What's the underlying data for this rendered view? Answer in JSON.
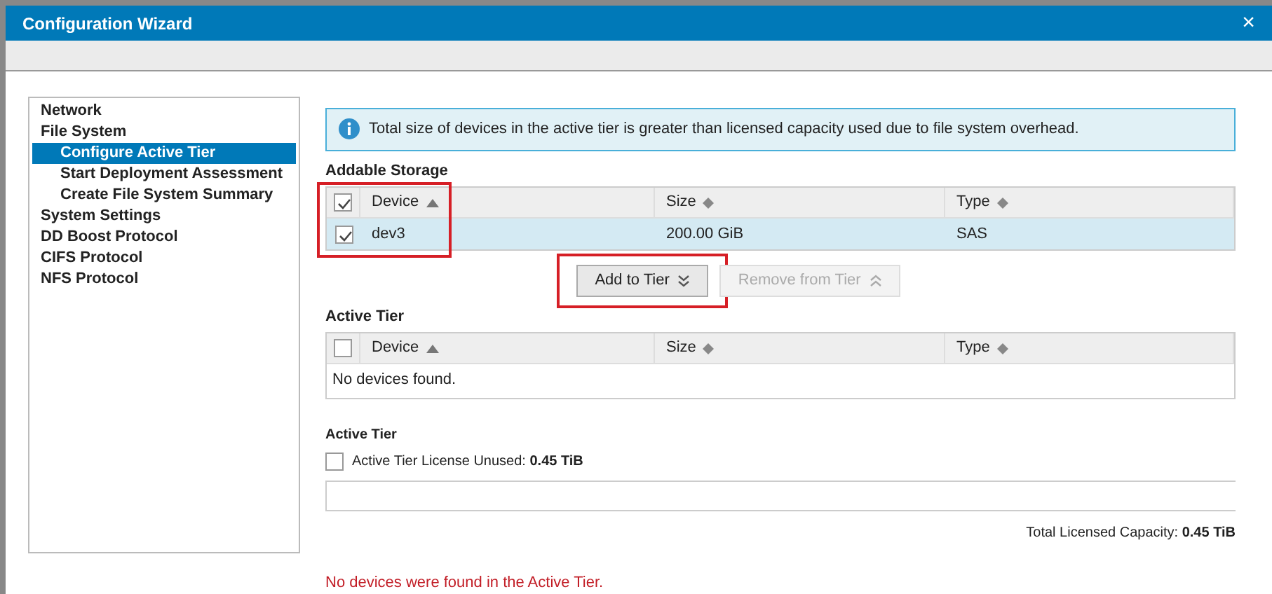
{
  "window": {
    "title": "Configuration Wizard",
    "close": "×"
  },
  "sidebar": {
    "items": [
      {
        "label": "Network",
        "selected": false
      },
      {
        "label": "File System",
        "selected": false,
        "children": [
          {
            "label": "Configure Active Tier",
            "selected": true
          },
          {
            "label": "Start Deployment Assessment",
            "selected": false
          },
          {
            "label": "Create File System Summary",
            "selected": false
          }
        ]
      },
      {
        "label": "System Settings",
        "selected": false
      },
      {
        "label": "DD Boost Protocol",
        "selected": false
      },
      {
        "label": "CIFS Protocol",
        "selected": false
      },
      {
        "label": "NFS Protocol",
        "selected": false
      }
    ]
  },
  "info": "Total size of devices in the active tier is greater than licensed capacity used due to file system overhead.",
  "addable_storage": {
    "title": "Addable Storage",
    "highlighted": true,
    "header_checked": true,
    "columns": [
      {
        "label": "Device",
        "kind": "sorted"
      },
      {
        "label": "Size",
        "kind": "sortable"
      },
      {
        "label": "Type",
        "kind": "sortable"
      }
    ],
    "rows": [
      {
        "cells": [
          "dev3",
          "200.00 GiB",
          "SAS"
        ],
        "checked": true,
        "selected": true
      }
    ]
  },
  "buttons": [
    {
      "label": "Add to Tier",
      "kind": "add",
      "disabled": false,
      "highlighted": true
    },
    {
      "label": "Remove from Tier",
      "kind": "remove",
      "disabled": true,
      "highlighted": false
    }
  ],
  "active_tier": {
    "title": "Active Tier",
    "header_checked": false,
    "columns": [
      {
        "label": "Device",
        "kind": "sorted"
      },
      {
        "label": "Size",
        "kind": "sortable"
      },
      {
        "label": "Type",
        "kind": "sortable"
      }
    ],
    "empty_text": "No devices found."
  },
  "license": {
    "title": "Active Tier",
    "legend": "Active Tier License Unused: **0.45 TiB**",
    "total": "Total Licensed Capacity: **0.45 TiB**"
  },
  "error": "No devices were found in the Active Tier."
}
